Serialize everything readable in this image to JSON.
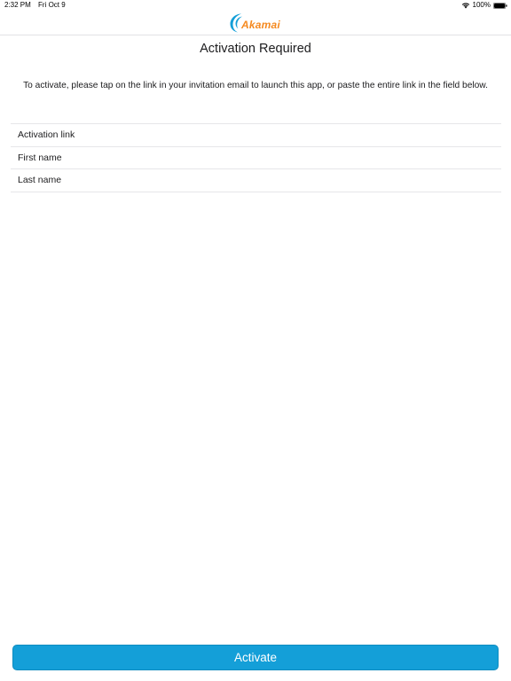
{
  "status_bar": {
    "time": "2:32 PM",
    "date": "Fri Oct 9",
    "battery": "100%"
  },
  "header": {
    "logo_text": "Akamai",
    "brand_color": "#f5891f",
    "logo_mark_color": "#149fd8"
  },
  "main": {
    "title": "Activation Required",
    "instructions": "To activate, please tap on the link in your invitation email to launch this app, or paste the entire link in the field below."
  },
  "form": {
    "activation_link": {
      "placeholder": "Activation link",
      "value": ""
    },
    "first_name": {
      "placeholder": "First name",
      "value": ""
    },
    "last_name": {
      "placeholder": "Last name",
      "value": ""
    }
  },
  "actions": {
    "activate_label": "Activate",
    "button_color": "#149fd8"
  }
}
